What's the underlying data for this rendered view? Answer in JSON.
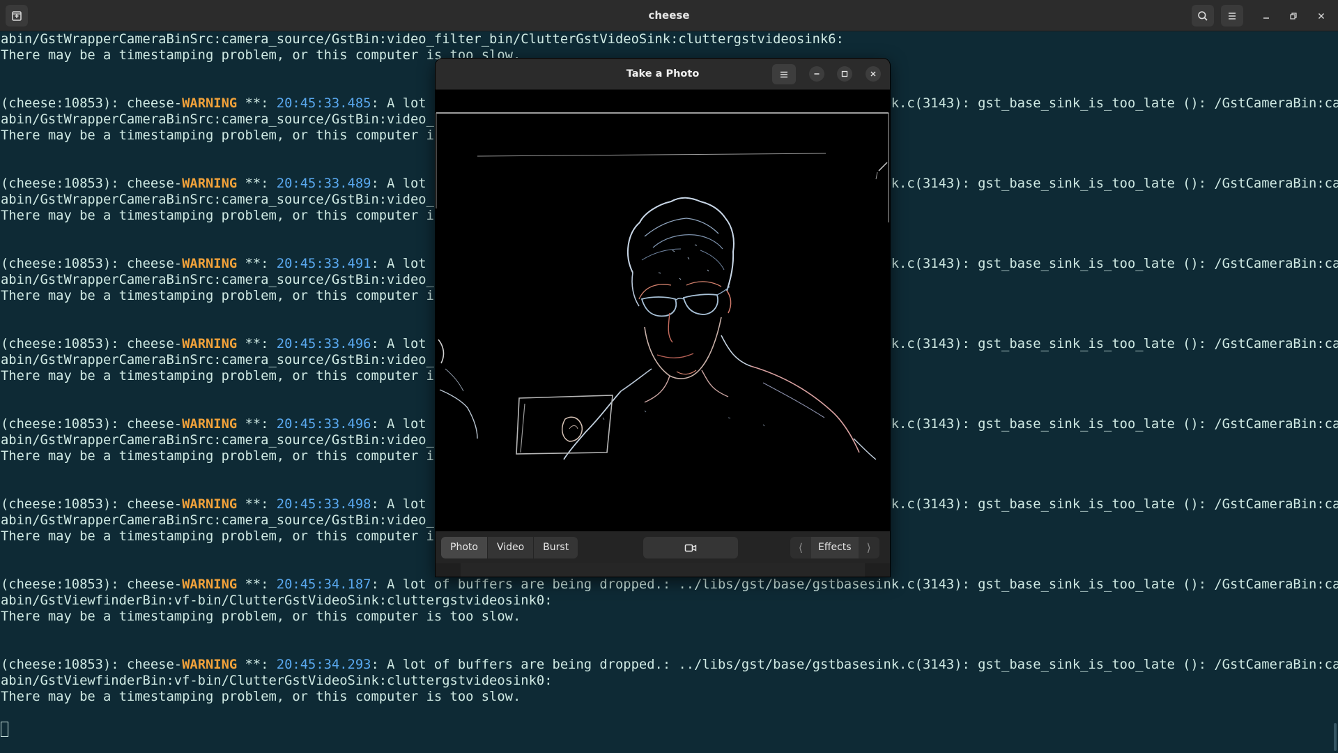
{
  "terminal": {
    "title": "cheese",
    "lines": [
      {
        "plain": "abin/GstWrapperCameraBinSrc:camera_source/GstBin:video_filter_bin/ClutterGstVideoSink:cluttergstvideosink6:"
      },
      {
        "plain": "There may be a timestamping problem, or this computer is too slow."
      },
      {
        "plain": ""
      },
      {
        "plain": ""
      },
      {
        "pre": "(cheese:10853): cheese-",
        "warn": "WARNING",
        "mid": " **: ",
        "time": "20:45:33.485",
        "rest": ": A lot of buffers are being dropped.: ../libs/gst/base/gstbasesink.c(3143): gst_base_sink_is_too_late (): /GstCameraBin:camer"
      },
      {
        "plain": "abin/GstWrapperCameraBinSrc:camera_source/GstBin:video_filter_bin/ClutterGstVideoSink:cluttergstvideosink6:"
      },
      {
        "plain": "There may be a timestamping problem, or this computer is too slow."
      },
      {
        "plain": ""
      },
      {
        "plain": ""
      },
      {
        "pre": "(cheese:10853): cheese-",
        "warn": "WARNING",
        "mid": " **: ",
        "time": "20:45:33.489",
        "rest": ": A lot of buffers are being dropped.: ../libs/gst/base/gstbasesink.c(3143): gst_base_sink_is_too_late (): /GstCameraBin:camer"
      },
      {
        "plain": "abin/GstWrapperCameraBinSrc:camera_source/GstBin:video_filter_bin/ClutterGstVideoSink:cluttergstvideosink6:"
      },
      {
        "plain": "There may be a timestamping problem, or this computer is too slow."
      },
      {
        "plain": ""
      },
      {
        "plain": ""
      },
      {
        "pre": "(cheese:10853): cheese-",
        "warn": "WARNING",
        "mid": " **: ",
        "time": "20:45:33.491",
        "rest": ": A lot of buffers are being dropped.: ../libs/gst/base/gstbasesink.c(3143): gst_base_sink_is_too_late (): /GstCameraBin:camer"
      },
      {
        "plain": "abin/GstWrapperCameraBinSrc:camera_source/GstBin:video_filter_bin/ClutterGstVideoSink:cluttergstvideosink6:"
      },
      {
        "plain": "There may be a timestamping problem, or this computer is too slow."
      },
      {
        "plain": ""
      },
      {
        "plain": ""
      },
      {
        "pre": "(cheese:10853): cheese-",
        "warn": "WARNING",
        "mid": " **: ",
        "time": "20:45:33.496",
        "rest": ": A lot of buffers are being dropped.: ../libs/gst/base/gstbasesink.c(3143): gst_base_sink_is_too_late (): /GstCameraBin:camer"
      },
      {
        "plain": "abin/GstWrapperCameraBinSrc:camera_source/GstBin:video_filter_bin/ClutterGstVideoSink:cluttergstvideosink6:"
      },
      {
        "plain": "There may be a timestamping problem, or this computer is too slow."
      },
      {
        "plain": ""
      },
      {
        "plain": ""
      },
      {
        "pre": "(cheese:10853): cheese-",
        "warn": "WARNING",
        "mid": " **: ",
        "time": "20:45:33.496",
        "rest": ": A lot of buffers are being dropped.: ../libs/gst/base/gstbasesink.c(3143): gst_base_sink_is_too_late (): /GstCameraBin:camer"
      },
      {
        "plain": "abin/GstWrapperCameraBinSrc:camera_source/GstBin:video_filter_bin/ClutterGstVideoSink:cluttergstvideosink6:"
      },
      {
        "plain": "There may be a timestamping problem, or this computer is too slow."
      },
      {
        "plain": ""
      },
      {
        "plain": ""
      },
      {
        "pre": "(cheese:10853): cheese-",
        "warn": "WARNING",
        "mid": " **: ",
        "time": "20:45:33.498",
        "rest": ": A lot of buffers are being dropped.: ../libs/gst/base/gstbasesink.c(3143): gst_base_sink_is_too_late (): /GstCameraBin:camer"
      },
      {
        "plain": "abin/GstWrapperCameraBinSrc:camera_source/GstBin:video_filter_bin/ClutterGstVideoSink:cluttergstvideosink6:"
      },
      {
        "plain": "There may be a timestamping problem, or this computer is too slow."
      },
      {
        "plain": ""
      },
      {
        "plain": ""
      },
      {
        "pre": "(cheese:10853): cheese-",
        "warn": "WARNING",
        "mid": " **: ",
        "time": "20:45:34.187",
        "rest": ": A lot of buffers are being dropped.: ../libs/gst/base/gstbasesink.c(3143): gst_base_sink_is_too_late (): /GstCameraBin:camer"
      },
      {
        "plain": "abin/GstViewfinderBin:vf-bin/ClutterGstVideoSink:cluttergstvideosink0:"
      },
      {
        "plain": "There may be a timestamping problem, or this computer is too slow."
      },
      {
        "plain": ""
      },
      {
        "plain": ""
      },
      {
        "pre": "(cheese:10853): cheese-",
        "warn": "WARNING",
        "mid": " **: ",
        "time": "20:45:34.293",
        "rest": ": A lot of buffers are being dropped.: ../libs/gst/base/gstbasesink.c(3143): gst_base_sink_is_too_late (): /GstCameraBin:camer"
      },
      {
        "plain": "abin/GstViewfinderBin:vf-bin/ClutterGstVideoSink:cluttergstvideosink0:"
      },
      {
        "plain": "There may be a timestamping problem, or this computer is too slow."
      }
    ]
  },
  "dialog": {
    "title": "Take a Photo",
    "modes": [
      "Photo",
      "Video",
      "Burst"
    ],
    "active_mode": "Photo",
    "effects_label": "Effects",
    "effects_prev": "⟨",
    "effects_next": "⟩",
    "strip_prev": "‹",
    "strip_next": "›"
  },
  "icons": {
    "terminal_new_tab": "new-tab-icon",
    "terminal_search": "search-icon",
    "terminal_menu": "hamburger-menu-icon",
    "window_minimize": "minimize-icon",
    "window_restore": "restore-icon",
    "window_close": "close-icon",
    "shutter": "camera-icon"
  },
  "colors": {
    "terminal_bg": "#0e2a35",
    "terminal_text": "#cfe9e3",
    "warning": "#f0a13a",
    "timestamp": "#5aa9f0"
  }
}
